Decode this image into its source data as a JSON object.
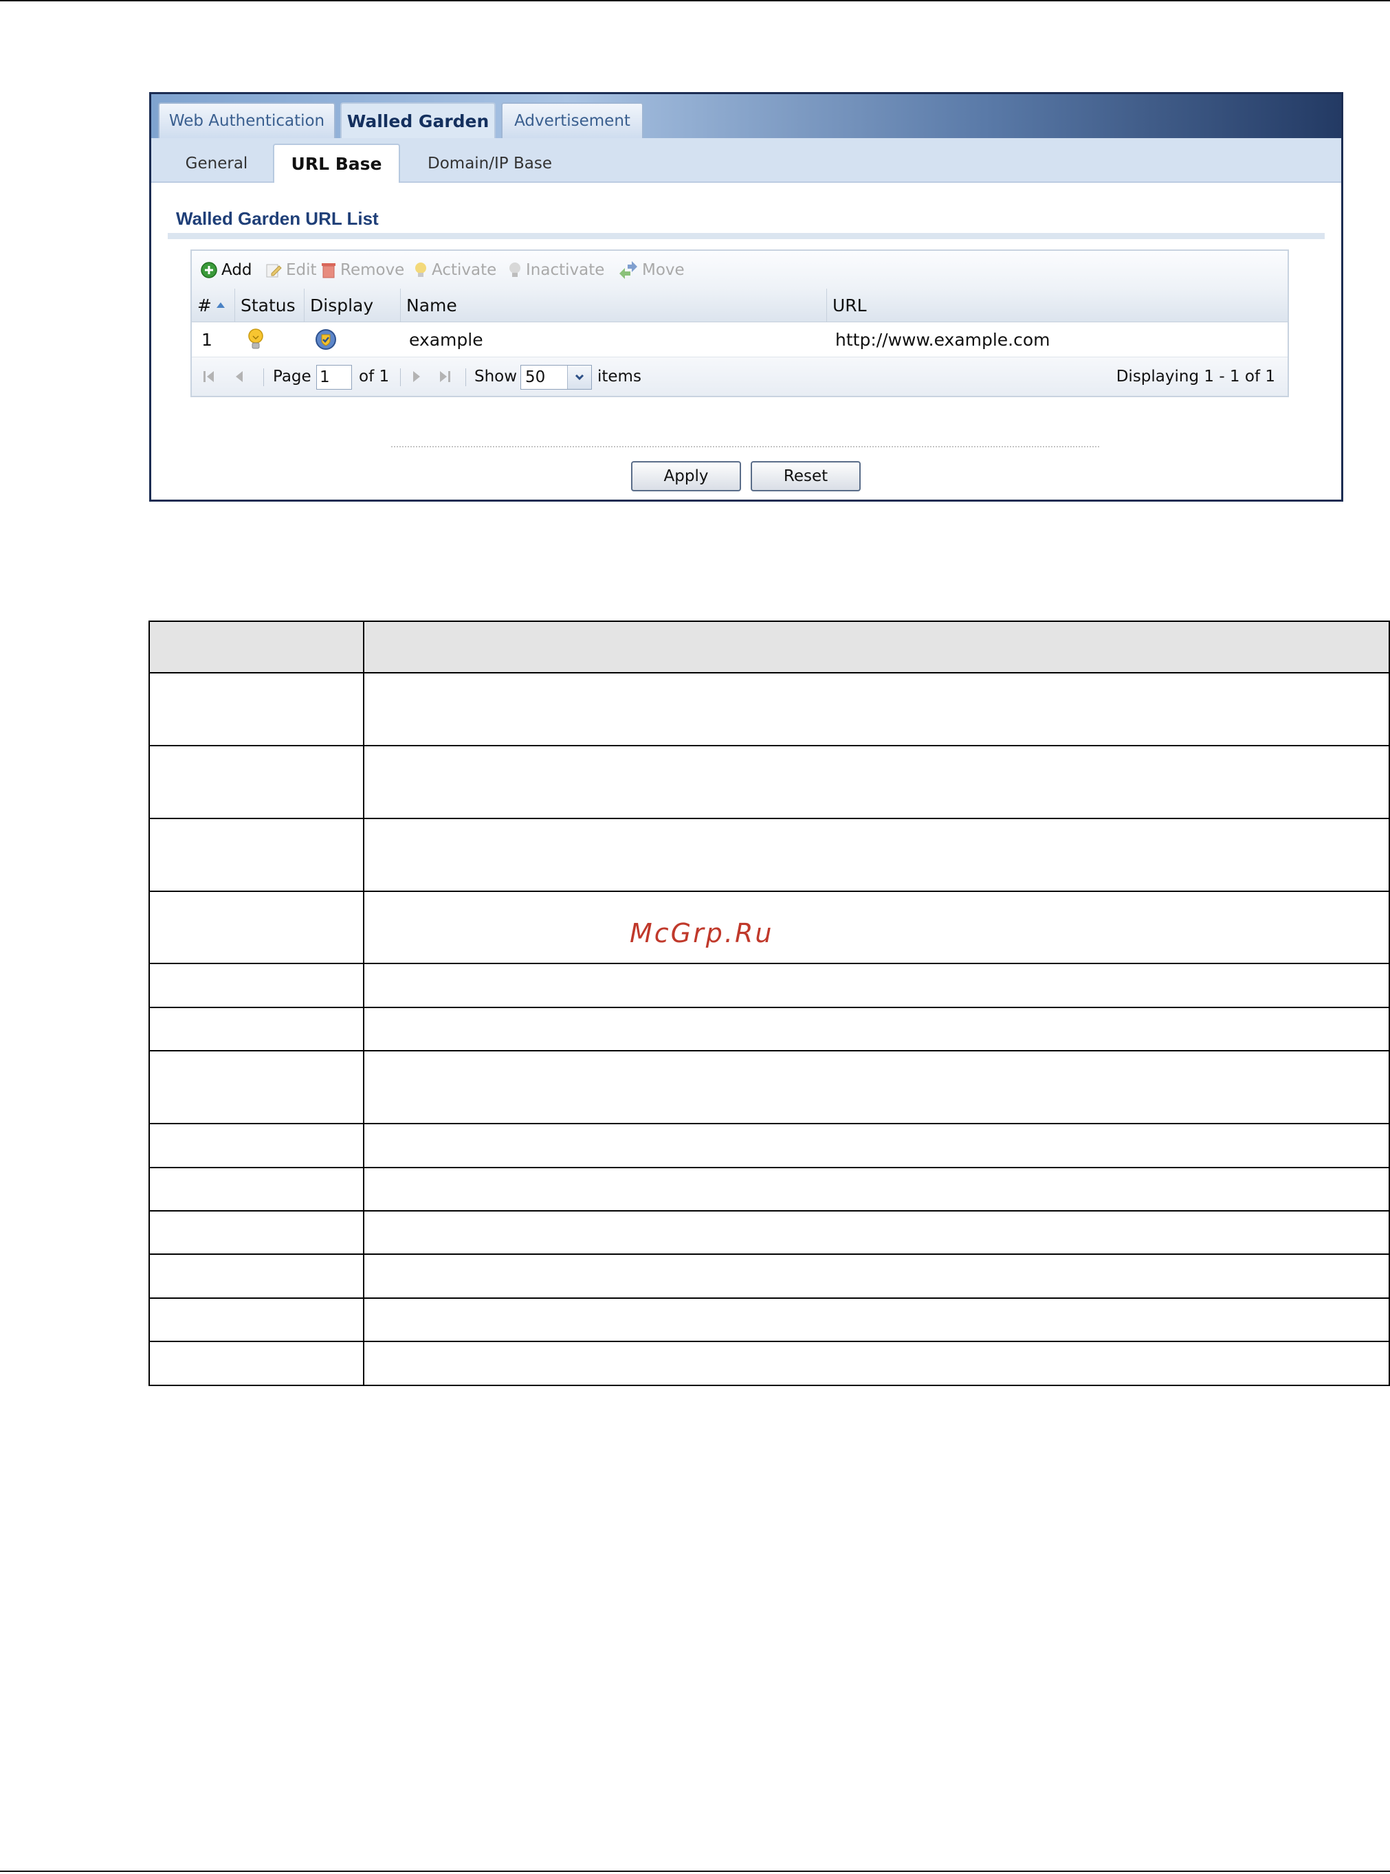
{
  "tabs": [
    {
      "label": "Web Authentication",
      "active": false
    },
    {
      "label": "Walled Garden",
      "active": true
    },
    {
      "label": "Advertisement",
      "active": false
    }
  ],
  "subtabs": [
    {
      "label": "General",
      "active": false
    },
    {
      "label": "URL Base",
      "active": true
    },
    {
      "label": "Domain/IP Base",
      "active": false
    }
  ],
  "section_title": "Walled Garden URL List",
  "toolbar": {
    "add": "Add",
    "edit": "Edit",
    "remove": "Remove",
    "activate": "Activate",
    "inactivate": "Inactivate",
    "move": "Move"
  },
  "table": {
    "columns": [
      "#",
      "Status",
      "Display",
      "Name",
      "URL"
    ],
    "rows": [
      {
        "num": "1",
        "status_icon": "lightbulb-on-icon",
        "display_icon": "shield-check-icon",
        "name": "example",
        "url": "http://www.example.com"
      }
    ]
  },
  "pager": {
    "page_label": "Page",
    "page_value": "1",
    "of_label": "of 1",
    "show_label": "Show",
    "show_value": "50",
    "items_label": "items",
    "displaying": "Displaying 1 - 1 of 1"
  },
  "buttons": {
    "apply": "Apply",
    "reset": "Reset"
  },
  "watermark": "McGrp.Ru",
  "colors": {
    "accent": "#1f3f78",
    "tab_active": "#dbe7f4",
    "watermark": "#c0392b"
  }
}
